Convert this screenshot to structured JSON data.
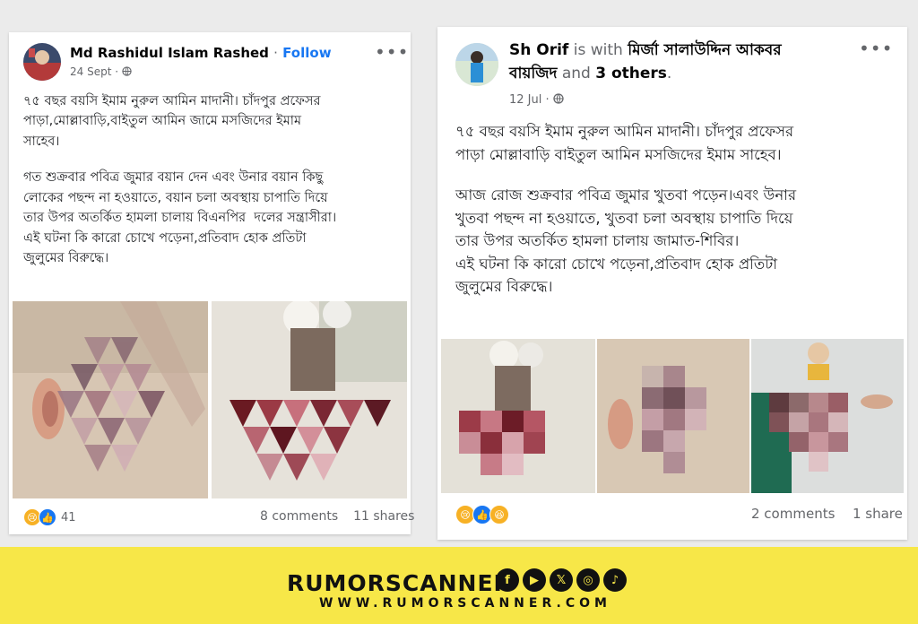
{
  "post1": {
    "author": "Md Rashidul Islam Rashed",
    "separator": "·",
    "follow": "Follow",
    "date": "24 Sept",
    "privacy_icon": "globe-icon",
    "more_icon": "more-options-icon",
    "paragraph1": "৭৫ বছর বয়সি ইমাম নুরুল আমিন মাদানী। চাঁদপুর প্রফেসর\nপাড়া,মোল্লাবাড়ি,বাইতুল আমিন জামে মসজিদের ইমাম\nসাহেব।",
    "paragraph2": "গত শুক্রবার পবিত্র জুমার বয়ান দেন এবং উনার বয়ান কিছু\nলোকের পছন্দ না হওয়াতে, বয়ান চলা অবস্থায় চাপাতি দিয়ে\nতার উপর অতর্কিত হামলা চালায় বিএনপির  দলের সন্ত্রাসীরা।\nএই ঘটনা কি কারো চোখে পড়েনা,প্রতিবাদ হোক প্রতিটা\nজুলুমের বিরুদ্ধে।",
    "reaction_count": "41",
    "comments": "8 comments",
    "shares": "11 shares"
  },
  "post2": {
    "author": "Sh Orif",
    "with_text": "is with",
    "tagged": "মির্জা সালাউদ্দিন আকবর",
    "tagged2": "বায়জিদ",
    "and_text": "and",
    "others": "3 others",
    "period": ".",
    "date": "12 Jul",
    "privacy_icon": "globe-icon",
    "more_icon": "more-options-icon",
    "paragraph1": "৭৫ বছর বয়সি ইমাম নুরুল আমিন মাদানী। চাঁদপুর প্রফেসর\nপাড়া মোল্লাবাড়ি বাইতুল আমিন মসজিদের ইমাম সাহেব।",
    "paragraph2": "আজ রোজ শুক্রবার পবিত্র জুমার খুতবা পড়েন।এবং উনার\nখুতবা পছন্দ না হওয়াতে, খুতবা চলা অবস্থায় চাপাতি দিয়ে\nতার উপর অতর্কিত হামলা চালায় জামাত-শিবির।\nএই ঘটনা কি কারো চোখে পড়েনা,প্রতিবাদ হোক প্রতিটা\nজুলুমের বিরুদ্ধে।",
    "comments": "2 comments",
    "shares": "1 share"
  },
  "banner": {
    "brand": "RUMORSCANNER",
    "url": "WWW.RUMORSCANNER.COM",
    "social_icons": [
      "facebook-icon",
      "youtube-icon",
      "x-icon",
      "instagram-icon",
      "tiktok-icon"
    ],
    "bg_color": "#f7e748"
  },
  "colors": {
    "link": "#1877f2",
    "muted": "#65676b"
  }
}
